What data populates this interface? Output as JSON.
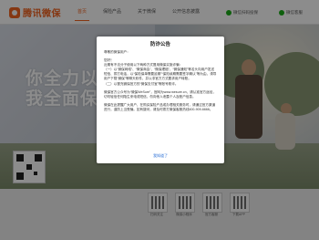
{
  "header": {
    "logo_text": "腾讯微保",
    "nav": [
      "首页",
      "保险产品",
      "关于微保",
      "公开信息披露"
    ],
    "active_index": 0,
    "buttons": [
      "微信扫码投保",
      "微信客服"
    ]
  },
  "hero": {
    "slogan_line1": "你全力以赴奋斗",
    "slogan_line2": "我全面保障守护"
  },
  "modal": {
    "title": "防诈公告",
    "greeting": "尊敬的微保用户：",
    "paragraphs": [
      "您好！",
      "近期有不法分子使用以下两种方式冒用微保实施诈骗：",
      "（一）以“微保网络”、“微保商会”、“微保理赔”、“微保通知”等名头向用户发送短信、拨打电话，以“保险保单需要延期”“保险续期需要签字确认”等为由，诱导用户下载“微保”等聊天软件，并以非官方方式要求用户转账。",
      "（二）以冒充微保官方的“微保支付宝”等账号欺诈。",
      "微保官方公众号为“微保WeSure”，官网为www.wesure.cn，请认准官方途径，切勿轻信任何陌生来电或短信，勿向他人泄露个人及账户信息。",
      "微保在此提醒广大用户，在购买保险产品或办理相关服务时，请通过官方渠道进行，谨防上当受骗。如有疑问，请及时拨打微保客服热线400-909-6666。"
    ],
    "link_label": "我知道了"
  },
  "footer": {
    "qr_labels": [
      "扫码关注",
      "微保小程序",
      "官方客服",
      "下载APP"
    ]
  }
}
